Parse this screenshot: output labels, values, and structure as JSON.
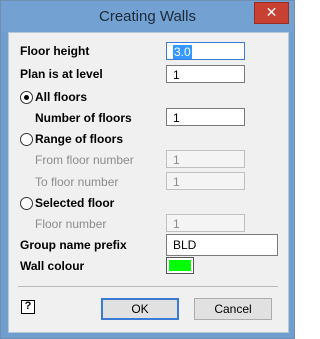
{
  "window": {
    "title": "Creating Walls",
    "close_glyph": "✕"
  },
  "form": {
    "floor_height": {
      "label": "Floor height",
      "value": "3.0"
    },
    "plan_level": {
      "label": "Plan is at level",
      "value": "1"
    },
    "all_floors": {
      "label": "All floors",
      "selected": true
    },
    "number_of_floors": {
      "label": "Number of floors",
      "value": "1"
    },
    "range_of_floors": {
      "label": "Range of floors"
    },
    "from_floor": {
      "label": "From floor number",
      "value": "1"
    },
    "to_floor": {
      "label": "To floor number",
      "value": "1"
    },
    "selected_floor": {
      "label": "Selected floor"
    },
    "floor_number": {
      "label": "Floor number",
      "value": "1"
    },
    "group_prefix": {
      "label": "Group name prefix",
      "value": "BLD"
    },
    "wall_colour": {
      "label": "Wall colour",
      "color": "#00ff00"
    }
  },
  "footer": {
    "help_glyph": "?",
    "ok_label": "OK",
    "cancel_label": "Cancel"
  }
}
